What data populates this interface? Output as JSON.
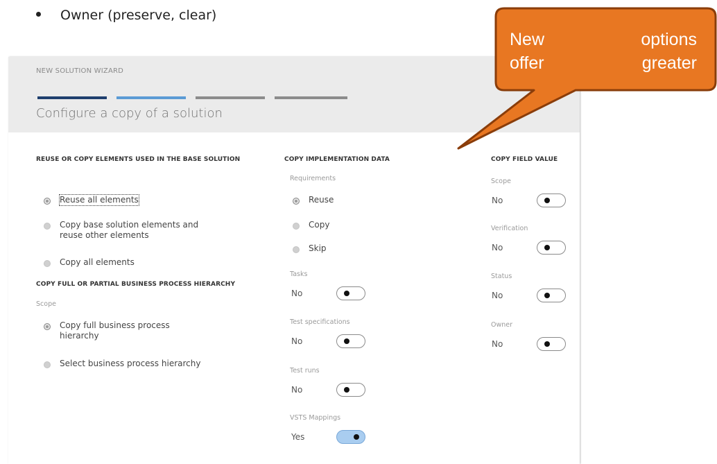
{
  "bullet": {
    "text": "Owner (preserve, clear)"
  },
  "wizard": {
    "label": "NEW SOLUTION WIZARD",
    "title": "Configure a copy of a solution",
    "steps_colors": [
      "#1f3f6e",
      "#5b9bd5",
      "#8c8c8c",
      "#8c8c8c"
    ]
  },
  "reuse_section": {
    "heading": "REUSE OR COPY ELEMENTS USED IN THE BASE SOLUTION",
    "options": [
      {
        "label": "Reuse all elements",
        "selected": true
      },
      {
        "label_line1": "Copy base solution elements and",
        "label_line2": "reuse other elements",
        "selected": false
      },
      {
        "label": "Copy all elements",
        "selected": false
      }
    ]
  },
  "hierarchy_section": {
    "heading": "COPY FULL OR PARTIAL BUSINESS PROCESS HIERARCHY",
    "scope_label": "Scope",
    "options": [
      {
        "label_line1": "Copy full business process",
        "label_line2": "hierarchy",
        "selected": true
      },
      {
        "label": "Select business process hierarchy",
        "selected": false
      }
    ]
  },
  "impl_section": {
    "heading": "COPY IMPLEMENTATION DATA",
    "requirements_label": "Requirements",
    "req_options": [
      {
        "label": "Reuse",
        "selected": true
      },
      {
        "label": "Copy",
        "selected": false
      },
      {
        "label": "Skip",
        "selected": false
      }
    ],
    "toggles": [
      {
        "label": "Tasks",
        "value": "No",
        "on": false
      },
      {
        "label": "Test specifications",
        "value": "No",
        "on": false
      },
      {
        "label": "Test runs",
        "value": "No",
        "on": false
      },
      {
        "label": "VSTS Mappings",
        "value": "Yes",
        "on": true
      }
    ]
  },
  "field_section": {
    "heading": "COPY FIELD VALUE",
    "toggles": [
      {
        "label": "Scope",
        "value": "No",
        "on": false
      },
      {
        "label": "Verification",
        "value": "No",
        "on": false
      },
      {
        "label": "Status",
        "value": "No",
        "on": false
      },
      {
        "label": "Owner",
        "value": "No",
        "on": false
      }
    ]
  },
  "callout": {
    "line1_a": "New",
    "line1_b": "options",
    "line2_a": "offer",
    "line2_b": "greater",
    "fill": "#e87722",
    "border": "#8a3d0a"
  }
}
